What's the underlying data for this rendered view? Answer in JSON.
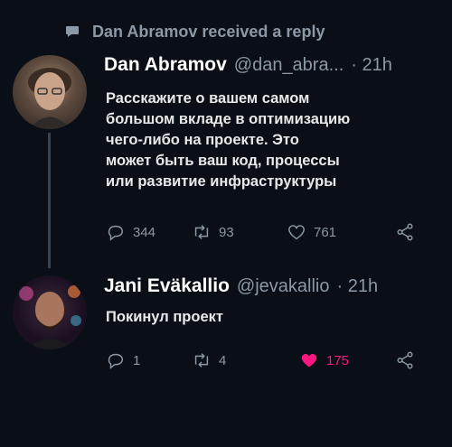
{
  "context": {
    "text": "Dan Abramov received a reply"
  },
  "tweet1": {
    "name": "Dan Abramov",
    "handle": "@dan_abra...",
    "time": "· 21h",
    "text": "Расскажите о вашем самом\nбольшом вкладе в оптимизацию\nчего-либо на проекте. Это\nможет быть ваш код, процессы\nили развитие инфраструктуры",
    "replies": "344",
    "retweets": "93",
    "likes": "761"
  },
  "tweet2": {
    "name": "Jani Eväkallio",
    "handle": "@jevakallio",
    "time": "· 21h",
    "text": "Покинул проект",
    "replies": "1",
    "retweets": "4",
    "likes": "175",
    "liked": true
  },
  "colors": {
    "background": "#0a0f17",
    "muted": "#8b98a5",
    "like_active": "#f91880",
    "thread_line": "#364453"
  }
}
